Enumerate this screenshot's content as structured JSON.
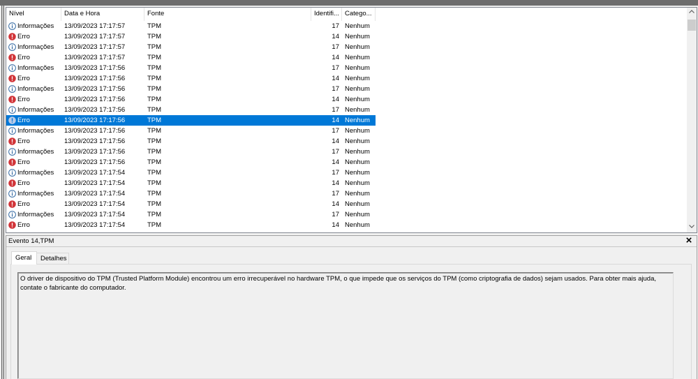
{
  "table": {
    "columns": [
      {
        "label": "Nível"
      },
      {
        "label": "Data e Hora"
      },
      {
        "label": "Fonte"
      },
      {
        "label": "Identifi..."
      },
      {
        "label": "Catego..."
      }
    ],
    "rows": [
      {
        "icon": "info-icon",
        "level": "Informações",
        "datetime": "13/09/2023 17:17:57",
        "source": "TPM",
        "event_id": "17",
        "category": "Nenhum",
        "selected": false
      },
      {
        "icon": "error-icon",
        "level": "Erro",
        "datetime": "13/09/2023 17:17:57",
        "source": "TPM",
        "event_id": "14",
        "category": "Nenhum",
        "selected": false
      },
      {
        "icon": "info-icon",
        "level": "Informações",
        "datetime": "13/09/2023 17:17:57",
        "source": "TPM",
        "event_id": "17",
        "category": "Nenhum",
        "selected": false
      },
      {
        "icon": "error-icon",
        "level": "Erro",
        "datetime": "13/09/2023 17:17:57",
        "source": "TPM",
        "event_id": "14",
        "category": "Nenhum",
        "selected": false
      },
      {
        "icon": "info-icon",
        "level": "Informações",
        "datetime": "13/09/2023 17:17:56",
        "source": "TPM",
        "event_id": "17",
        "category": "Nenhum",
        "selected": false
      },
      {
        "icon": "error-icon",
        "level": "Erro",
        "datetime": "13/09/2023 17:17:56",
        "source": "TPM",
        "event_id": "14",
        "category": "Nenhum",
        "selected": false
      },
      {
        "icon": "info-icon",
        "level": "Informações",
        "datetime": "13/09/2023 17:17:56",
        "source": "TPM",
        "event_id": "17",
        "category": "Nenhum",
        "selected": false
      },
      {
        "icon": "error-icon",
        "level": "Erro",
        "datetime": "13/09/2023 17:17:56",
        "source": "TPM",
        "event_id": "14",
        "category": "Nenhum",
        "selected": false
      },
      {
        "icon": "info-icon",
        "level": "Informações",
        "datetime": "13/09/2023 17:17:56",
        "source": "TPM",
        "event_id": "17",
        "category": "Nenhum",
        "selected": false
      },
      {
        "icon": "error-icon",
        "level": "Erro",
        "datetime": "13/09/2023 17:17:56",
        "source": "TPM",
        "event_id": "14",
        "category": "Nenhum",
        "selected": true
      },
      {
        "icon": "info-icon",
        "level": "Informações",
        "datetime": "13/09/2023 17:17:56",
        "source": "TPM",
        "event_id": "17",
        "category": "Nenhum",
        "selected": false
      },
      {
        "icon": "error-icon",
        "level": "Erro",
        "datetime": "13/09/2023 17:17:56",
        "source": "TPM",
        "event_id": "14",
        "category": "Nenhum",
        "selected": false
      },
      {
        "icon": "info-icon",
        "level": "Informações",
        "datetime": "13/09/2023 17:17:56",
        "source": "TPM",
        "event_id": "17",
        "category": "Nenhum",
        "selected": false
      },
      {
        "icon": "error-icon",
        "level": "Erro",
        "datetime": "13/09/2023 17:17:56",
        "source": "TPM",
        "event_id": "14",
        "category": "Nenhum",
        "selected": false
      },
      {
        "icon": "info-icon",
        "level": "Informações",
        "datetime": "13/09/2023 17:17:54",
        "source": "TPM",
        "event_id": "17",
        "category": "Nenhum",
        "selected": false
      },
      {
        "icon": "error-icon",
        "level": "Erro",
        "datetime": "13/09/2023 17:17:54",
        "source": "TPM",
        "event_id": "14",
        "category": "Nenhum",
        "selected": false
      },
      {
        "icon": "info-icon",
        "level": "Informações",
        "datetime": "13/09/2023 17:17:54",
        "source": "TPM",
        "event_id": "17",
        "category": "Nenhum",
        "selected": false
      },
      {
        "icon": "error-icon",
        "level": "Erro",
        "datetime": "13/09/2023 17:17:54",
        "source": "TPM",
        "event_id": "14",
        "category": "Nenhum",
        "selected": false
      },
      {
        "icon": "info-icon",
        "level": "Informações",
        "datetime": "13/09/2023 17:17:54",
        "source": "TPM",
        "event_id": "17",
        "category": "Nenhum",
        "selected": false
      },
      {
        "icon": "error-icon",
        "level": "Erro",
        "datetime": "13/09/2023 17:17:54",
        "source": "TPM",
        "event_id": "14",
        "category": "Nenhum",
        "selected": false
      }
    ]
  },
  "scrollbar": {
    "position": 0
  },
  "details": {
    "title": "Evento 14,TPM",
    "tabs": [
      {
        "label": "Geral",
        "selected": true
      },
      {
        "label": "Detalhes",
        "selected": false
      }
    ],
    "description": "O driver de dispositivo do TPM (Trusted Platform Module) encontrou um erro irrecuperável no hardware TPM, o que impede que os serviços do TPM (como criptografia de dados) sejam usados. Para obter mais ajuda, contate o fabricante do computador."
  },
  "icons": {
    "info": "info-icon",
    "error": "error-icon",
    "close": "close-icon",
    "scroll_up": "chevron-up-icon",
    "scroll_down": "chevron-down-icon"
  },
  "colors": {
    "selection": "#0078d7",
    "error": "#d13438",
    "info": "#3a6ea5",
    "window_frame": "#6d6d6d"
  }
}
